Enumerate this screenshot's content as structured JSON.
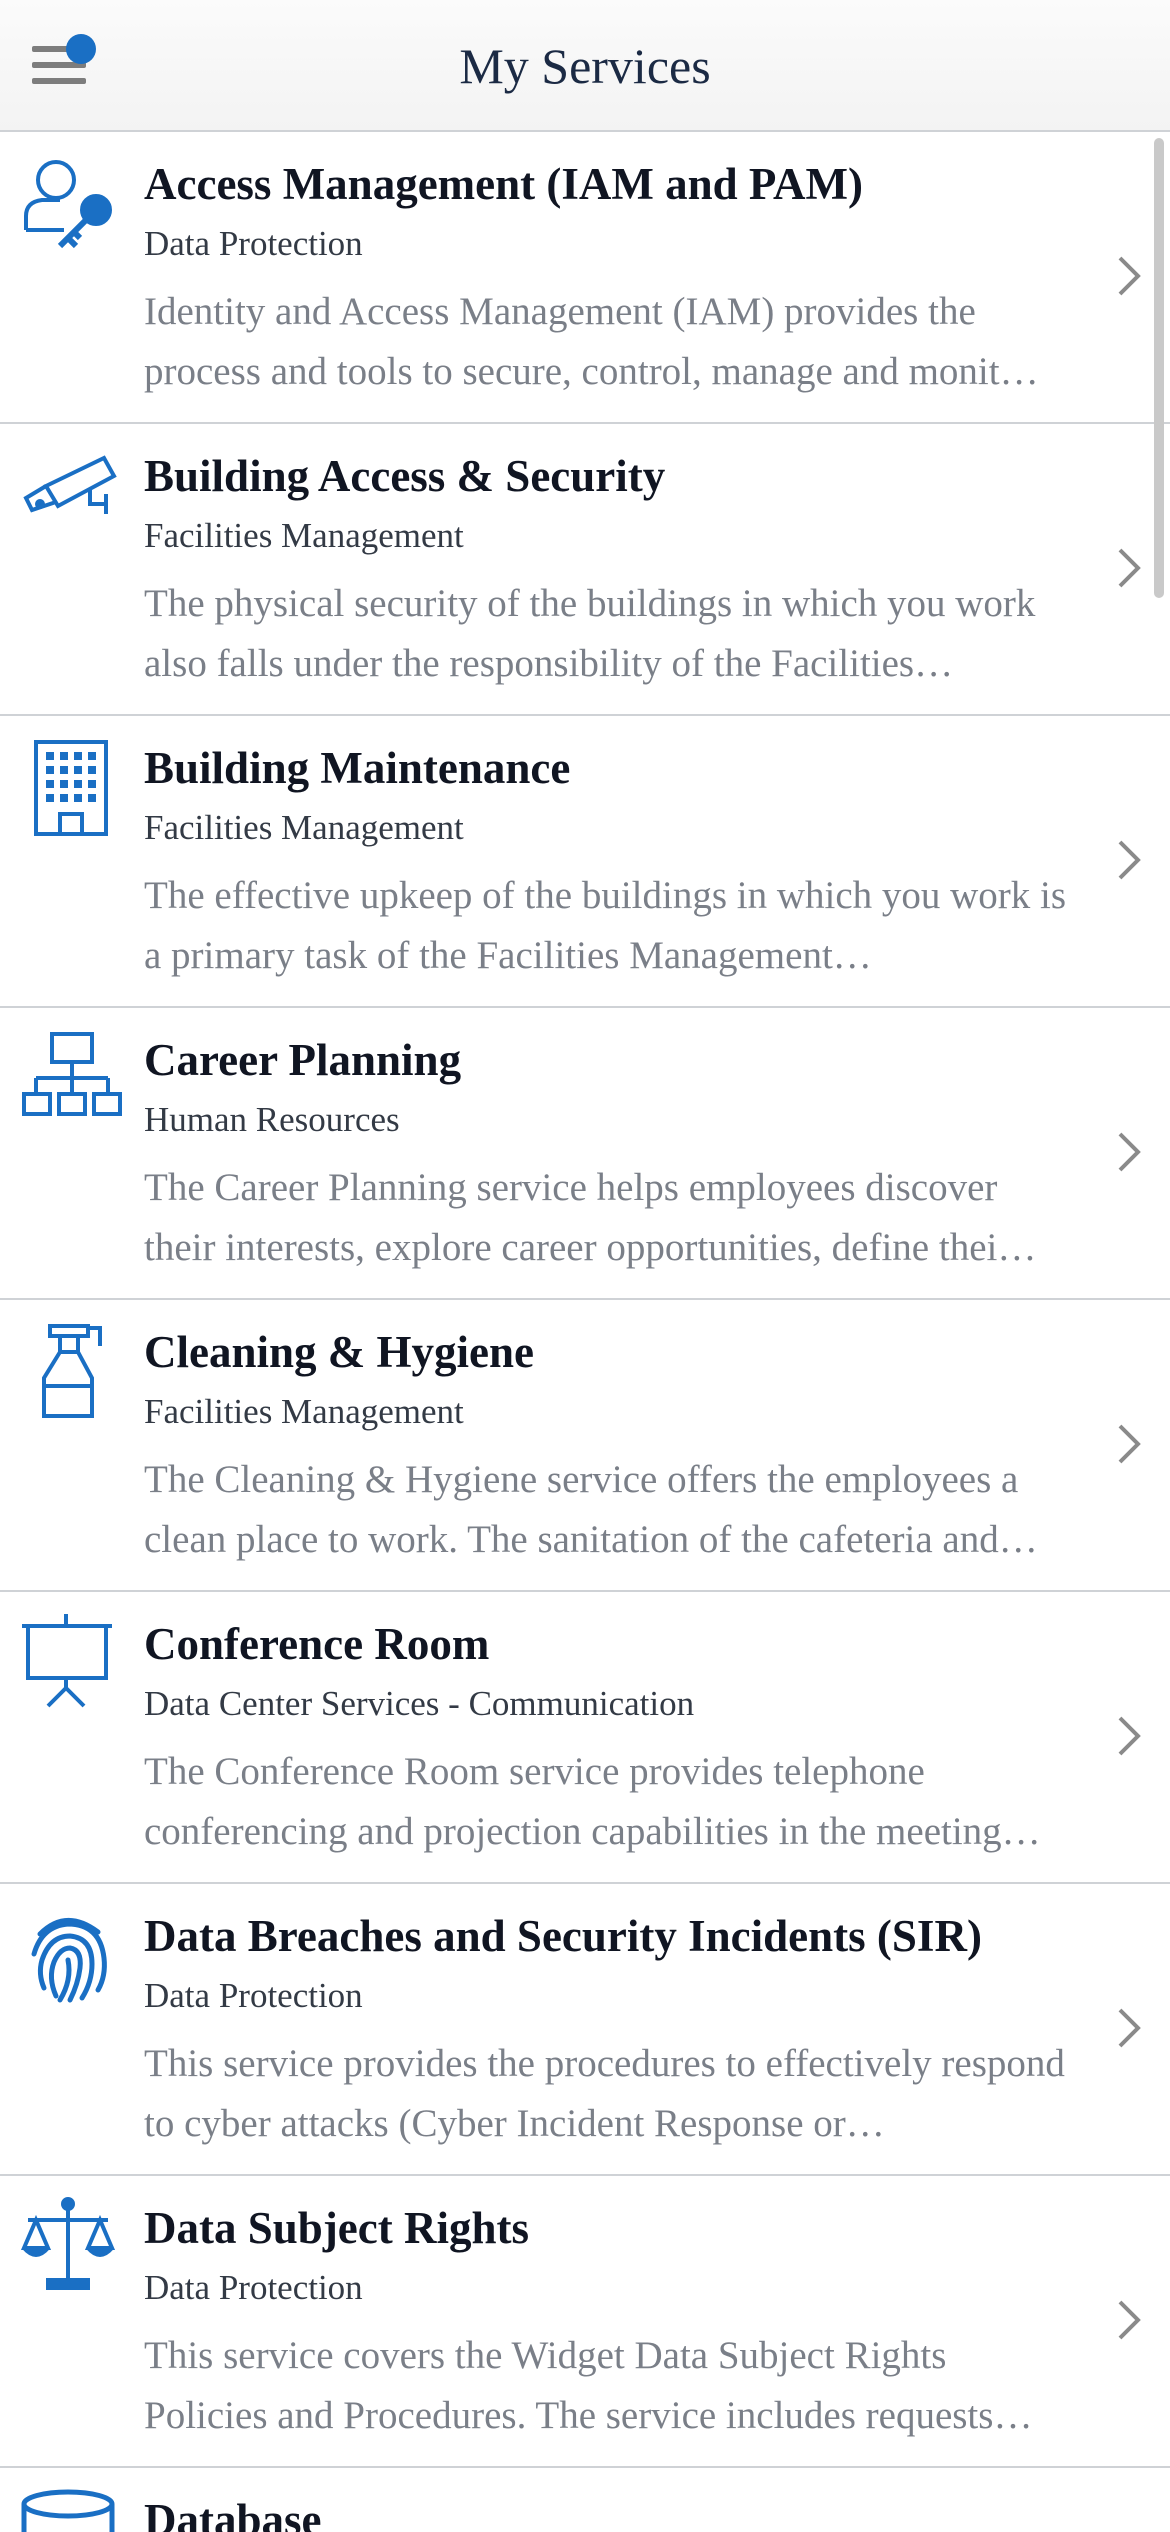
{
  "header": {
    "title": "My Services",
    "menu_icon": "hamburger-menu-icon",
    "notification_dot_color": "#1a6fc4"
  },
  "accent_color": "#1a6fc4",
  "services": [
    {
      "name": "Access Management (IAM and PAM)",
      "category": "Data Protection",
      "description": "Identity and Access Management (IAM) provides the process and tools to secure, control, manage and monit…",
      "icon": "user-key-icon"
    },
    {
      "name": "Building Access & Security",
      "category": "Facilities Management",
      "description": "The physical security of the buildings in which you work also falls under the responsibility of the Facilities…",
      "icon": "security-camera-icon"
    },
    {
      "name": "Building Maintenance",
      "category": "Facilities Management",
      "description": "The effective upkeep of the buildings in which you work is a primary task of the Facilities Management…",
      "icon": "building-icon"
    },
    {
      "name": "Career Planning",
      "category": "Human Resources",
      "description": "The Career Planning service helps employees discover their interests, explore career opportunities, define thei…",
      "icon": "org-chart-icon"
    },
    {
      "name": "Cleaning & Hygiene",
      "category": "Facilities Management",
      "description": "The Cleaning & Hygiene service offers the employees a clean place to work. The sanitation of the cafeteria and…",
      "icon": "spray-bottle-icon"
    },
    {
      "name": "Conference Room",
      "category": "Data Center Services - Communication",
      "description": "The Conference Room service provides telephone conferencing and projection capabilities in the meeting…",
      "icon": "projector-screen-icon"
    },
    {
      "name": "Data Breaches and Security Incidents (SIR)",
      "category": "Data Protection",
      "description": "This service provides the procedures to effectively respond to cyber attacks (Cyber Incident Response or…",
      "icon": "fingerprint-icon"
    },
    {
      "name": "Data Subject Rights",
      "category": "Data Protection",
      "description": "This service covers the Widget Data Subject Rights Policies and Procedures. The service includes requests…",
      "icon": "scales-icon"
    },
    {
      "name": "Database",
      "category": "",
      "description": "",
      "icon": "database-icon"
    }
  ]
}
